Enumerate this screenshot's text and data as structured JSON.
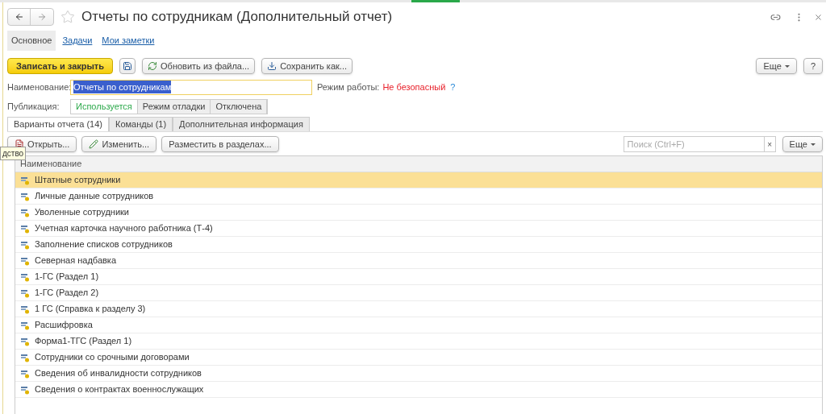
{
  "tooltip": "дство",
  "window": {
    "title": "Отчеты по сотрудникам (Дополнительный отчет)",
    "favorite": false
  },
  "nav": [
    {
      "label": "Основное",
      "selected": true
    },
    {
      "label": "Задачи",
      "selected": false
    },
    {
      "label": "Мои заметки",
      "selected": false
    }
  ],
  "toolbar": {
    "primary": "Записать и закрыть",
    "buttons": [
      {
        "kind": "update",
        "label": "Обновить из файла..."
      },
      {
        "kind": "download",
        "label": "Сохранить как..."
      }
    ],
    "more": "Еще",
    "help": "?"
  },
  "name_field": {
    "label": "Наименование:",
    "value": "Отчеты по сотрудникам"
  },
  "mode": {
    "label": "Режим работы:",
    "value": "Не безопасный",
    "help": "?"
  },
  "publication": {
    "label": "Публикация:",
    "options": [
      {
        "label": "Используется",
        "selected": true
      },
      {
        "label": "Режим отладки",
        "selected": false
      },
      {
        "label": "Отключена",
        "selected": false
      }
    ]
  },
  "tabs": [
    {
      "label": "Варианты отчета (14)",
      "selected": true
    },
    {
      "label": "Команды (1)",
      "selected": false
    },
    {
      "label": "Дополнительная информация",
      "selected": false
    }
  ],
  "list_toolbar": {
    "buttons": [
      {
        "kind": "open",
        "label": "Открыть..."
      },
      {
        "kind": "edit",
        "label": "Изменить..."
      },
      {
        "kind": "plain",
        "label": "Разместить в разделах..."
      }
    ],
    "search_placeholder": "Поиск (Ctrl+F)",
    "clear": "×",
    "more": "Еще"
  },
  "table": {
    "columns": [
      "Наименование"
    ],
    "rows": [
      {
        "name": "Штатные сотрудники",
        "selected": true
      },
      {
        "name": "Личные данные сотрудников",
        "selected": false
      },
      {
        "name": "Уволенные сотрудники",
        "selected": false
      },
      {
        "name": "Учетная карточка научного работника (Т-4)",
        "selected": false
      },
      {
        "name": "Заполнение списков сотрудников",
        "selected": false
      },
      {
        "name": "Северная надбавка",
        "selected": false
      },
      {
        "name": "1-ГС (Раздел 1)",
        "selected": false
      },
      {
        "name": "1-ГС (Раздел 2)",
        "selected": false
      },
      {
        "name": "1 ГС (Справка к разделу 3)",
        "selected": false
      },
      {
        "name": "Расшифровка",
        "selected": false
      },
      {
        "name": "Форма1-ТГС (Раздел 1)",
        "selected": false
      },
      {
        "name": "Сотрудники со срочными договорами",
        "selected": false
      },
      {
        "name": "Сведения об инвалидности сотрудников",
        "selected": false
      },
      {
        "name": "Сведения о контрактах военнослужащих",
        "selected": false
      }
    ]
  }
}
